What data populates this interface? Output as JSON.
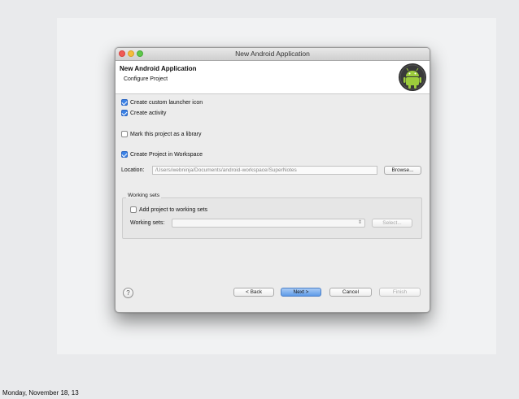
{
  "window": {
    "title": "New Android Application"
  },
  "header": {
    "title": "New Android Application",
    "subtitle": "Configure Project"
  },
  "options": {
    "create_launcher_icon": {
      "label": "Create custom launcher icon",
      "checked": true
    },
    "create_activity": {
      "label": "Create activity",
      "checked": true
    },
    "mark_library": {
      "label": "Mark this project as a library",
      "checked": false
    },
    "create_in_workspace": {
      "label": "Create Project in Workspace",
      "checked": true
    }
  },
  "location": {
    "label": "Location:",
    "value": "/Users/webninja/Documents/android-workspace/SuperNotes",
    "browse_label": "Browse..."
  },
  "working_sets": {
    "group_title": "Working sets",
    "add_label": "Add project to working sets",
    "add_checked": false,
    "sets_label": "Working sets:",
    "sets_value": "",
    "select_label": "Select..."
  },
  "buttons": {
    "back": "< Back",
    "next": "Next >",
    "cancel": "Cancel",
    "finish": "Finish",
    "help": "?"
  },
  "footer": {
    "date": "Monday, November 18, 13"
  },
  "colors": {
    "accent": "#3b82e6",
    "android_green": "#8bc34a"
  }
}
